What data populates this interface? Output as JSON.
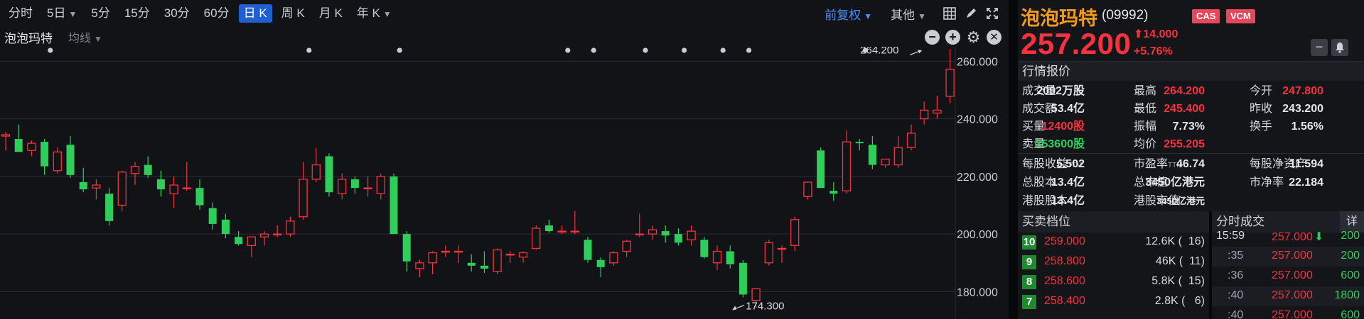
{
  "toolbar": {
    "timeframes": [
      "分时",
      "5日",
      "5分",
      "15分",
      "30分",
      "60分",
      "日 K",
      "周 K",
      "月 K",
      "年 K"
    ],
    "dropdown_flags": [
      false,
      true,
      false,
      false,
      false,
      false,
      false,
      false,
      false,
      true
    ],
    "active_index": 6,
    "adjust": "前复权",
    "other": "其他"
  },
  "chart_header": {
    "stock": "泡泡玛特",
    "indicator": "均线"
  },
  "chart_data": {
    "type": "candlestick",
    "y_ticks": [
      "260.000",
      "240.000",
      "220.000",
      "200.000",
      "180.000"
    ],
    "ylim": [
      170.5,
      265
    ],
    "up_color": "#f4333e",
    "down_color": "#2fce5a",
    "annotations": [
      {
        "text": "264.200",
        "value": 264.2,
        "index": 71
      },
      {
        "text": "174.300",
        "value": 174.3,
        "index": 56
      }
    ],
    "event_marker_indices": [
      4,
      24,
      31,
      44,
      46,
      50,
      53,
      56,
      58,
      67
    ],
    "candles": [
      {
        "o": 234,
        "h": 235.5,
        "l": 229,
        "c": 234.5
      },
      {
        "o": 233,
        "h": 238,
        "l": 228.5,
        "c": 228.5
      },
      {
        "o": 229,
        "h": 232.5,
        "l": 227,
        "c": 231.5
      },
      {
        "o": 232,
        "h": 233,
        "l": 220.5,
        "c": 223.5
      },
      {
        "o": 222,
        "h": 230,
        "l": 221,
        "c": 228.5
      },
      {
        "o": 231,
        "h": 234,
        "l": 219.5,
        "c": 220.5
      },
      {
        "o": 218,
        "h": 223,
        "l": 214.5,
        "c": 215.5
      },
      {
        "o": 216,
        "h": 219,
        "l": 212,
        "c": 217
      },
      {
        "o": 214,
        "h": 216,
        "l": 203,
        "c": 204.5
      },
      {
        "o": 210,
        "h": 222,
        "l": 208,
        "c": 221.5
      },
      {
        "o": 221,
        "h": 225,
        "l": 217,
        "c": 223.5
      },
      {
        "o": 224,
        "h": 227,
        "l": 219.5,
        "c": 220.5
      },
      {
        "o": 219,
        "h": 222,
        "l": 213,
        "c": 215.5
      },
      {
        "o": 214,
        "h": 220,
        "l": 209,
        "c": 217
      },
      {
        "o": 216,
        "h": 225,
        "l": 215,
        "c": 216
      },
      {
        "o": 216,
        "h": 219,
        "l": 208.5,
        "c": 210
      },
      {
        "o": 209,
        "h": 211,
        "l": 201.5,
        "c": 203.5
      },
      {
        "o": 205,
        "h": 207,
        "l": 198.5,
        "c": 200
      },
      {
        "o": 199,
        "h": 201,
        "l": 196,
        "c": 196.5
      },
      {
        "o": 196,
        "h": 198,
        "l": 192,
        "c": 199
      },
      {
        "o": 199,
        "h": 201,
        "l": 196,
        "c": 200
      },
      {
        "o": 200,
        "h": 203,
        "l": 199,
        "c": 200
      },
      {
        "o": 200,
        "h": 206,
        "l": 199,
        "c": 204.5
      },
      {
        "o": 206,
        "h": 225,
        "l": 205,
        "c": 219
      },
      {
        "o": 219,
        "h": 230,
        "l": 218,
        "c": 224
      },
      {
        "o": 227,
        "h": 228,
        "l": 213,
        "c": 214.5
      },
      {
        "o": 214,
        "h": 221,
        "l": 212,
        "c": 219
      },
      {
        "o": 219,
        "h": 220,
        "l": 214,
        "c": 216
      },
      {
        "o": 216,
        "h": 220,
        "l": 213,
        "c": 216
      },
      {
        "o": 214,
        "h": 221,
        "l": 212,
        "c": 220
      },
      {
        "o": 220,
        "h": 221,
        "l": 200,
        "c": 200
      },
      {
        "o": 200,
        "h": 201,
        "l": 187,
        "c": 190.5
      },
      {
        "o": 188,
        "h": 191,
        "l": 185,
        "c": 190
      },
      {
        "o": 190,
        "h": 194,
        "l": 186,
        "c": 193.5
      },
      {
        "o": 194,
        "h": 196,
        "l": 192,
        "c": 194
      },
      {
        "o": 194,
        "h": 196,
        "l": 190,
        "c": 194
      },
      {
        "o": 190,
        "h": 193,
        "l": 187,
        "c": 189
      },
      {
        "o": 189,
        "h": 194,
        "l": 186.5,
        "c": 188
      },
      {
        "o": 187,
        "h": 195,
        "l": 186,
        "c": 194.5
      },
      {
        "o": 193,
        "h": 194,
        "l": 190,
        "c": 193
      },
      {
        "o": 192,
        "h": 194,
        "l": 190,
        "c": 193.5
      },
      {
        "o": 195,
        "h": 203,
        "l": 194.5,
        "c": 202
      },
      {
        "o": 203,
        "h": 205,
        "l": 200.5,
        "c": 201
      },
      {
        "o": 201,
        "h": 203,
        "l": 200,
        "c": 201
      },
      {
        "o": 201,
        "h": 208,
        "l": 200,
        "c": 201
      },
      {
        "o": 198,
        "h": 199,
        "l": 190,
        "c": 191
      },
      {
        "o": 191,
        "h": 192,
        "l": 185,
        "c": 188.5
      },
      {
        "o": 190,
        "h": 194,
        "l": 189,
        "c": 193.5
      },
      {
        "o": 194,
        "h": 198,
        "l": 192,
        "c": 197.5
      },
      {
        "o": 200,
        "h": 207,
        "l": 199,
        "c": 200
      },
      {
        "o": 200,
        "h": 203,
        "l": 198,
        "c": 201.5
      },
      {
        "o": 201,
        "h": 203,
        "l": 197,
        "c": 199.5
      },
      {
        "o": 200,
        "h": 202,
        "l": 196,
        "c": 197
      },
      {
        "o": 198,
        "h": 203,
        "l": 196,
        "c": 201
      },
      {
        "o": 198,
        "h": 199,
        "l": 191.5,
        "c": 192
      },
      {
        "o": 190,
        "h": 196,
        "l": 187.5,
        "c": 194
      },
      {
        "o": 194,
        "h": 196,
        "l": 188,
        "c": 189.5
      },
      {
        "o": 190,
        "h": 191,
        "l": 178,
        "c": 179
      },
      {
        "o": 177,
        "h": 181,
        "l": 174.3,
        "c": 181
      },
      {
        "o": 190,
        "h": 198,
        "l": 189,
        "c": 197
      },
      {
        "o": 195,
        "h": 196,
        "l": 190,
        "c": 195
      },
      {
        "o": 196,
        "h": 206,
        "l": 194,
        "c": 205
      },
      {
        "o": 213,
        "h": 218,
        "l": 212,
        "c": 218
      },
      {
        "o": 229,
        "h": 230,
        "l": 216,
        "c": 216
      },
      {
        "o": 215,
        "h": 218,
        "l": 211.5,
        "c": 214
      },
      {
        "o": 215,
        "h": 236,
        "l": 214,
        "c": 232
      },
      {
        "o": 232,
        "h": 233,
        "l": 229,
        "c": 231.5
      },
      {
        "o": 231,
        "h": 234,
        "l": 222.5,
        "c": 224
      },
      {
        "o": 224,
        "h": 226,
        "l": 223,
        "c": 226
      },
      {
        "o": 224,
        "h": 234,
        "l": 223,
        "c": 230
      },
      {
        "o": 230,
        "h": 238,
        "l": 229,
        "c": 235
      },
      {
        "o": 240,
        "h": 246,
        "l": 238,
        "c": 243
      },
      {
        "o": 242,
        "h": 248,
        "l": 240,
        "c": 243
      },
      {
        "o": 247.8,
        "h": 264.2,
        "l": 245.4,
        "c": 257.2
      }
    ]
  },
  "quote": {
    "name": "泡泡玛特",
    "code": "(09992)",
    "tags": [
      "CAS",
      "VCM"
    ],
    "price": "257.200",
    "change": "14.000",
    "change_pct": "+5.76%",
    "btn_minus": "−",
    "section_title": "行情报价",
    "rows": [
      [
        {
          "label": "成交量",
          "value": "2092万股",
          "color": "neutral"
        },
        {
          "label": "最高",
          "value": "264.200",
          "color": "red"
        },
        {
          "label": "今开",
          "value": "247.800",
          "color": "red"
        }
      ],
      [
        {
          "label": "成交额",
          "value": "53.4亿",
          "color": "neutral"
        },
        {
          "label": "最低",
          "value": "245.400",
          "color": "red"
        },
        {
          "label": "昨收",
          "value": "243.200",
          "color": "neutral"
        }
      ],
      [
        {
          "label": "买量",
          "value": "12400股",
          "color": "red"
        },
        {
          "label": "振幅",
          "value": "7.73%",
          "color": "neutral"
        },
        {
          "label": "换手",
          "value": "1.56%",
          "color": "neutral"
        }
      ],
      [
        {
          "label": "卖量",
          "value": "353600股",
          "color": "green"
        },
        {
          "label": "均价",
          "value": "255.205",
          "color": "red"
        }
      ]
    ],
    "fundamentals": [
      [
        {
          "label": "每股收益",
          "sup": "TTM",
          "value": "5.502"
        },
        {
          "label": "市盈率",
          "sup": "TTM",
          "value": "46.74"
        },
        {
          "label": "每股净资产",
          "sup": "",
          "value": "11.594"
        }
      ],
      [
        {
          "label": "总股本",
          "sup": "",
          "value": "13.4亿"
        },
        {
          "label": "总市值",
          "sup": "",
          "value": "3450亿港元"
        },
        {
          "label": "市净率",
          "sup": "",
          "value": "22.184"
        }
      ],
      [
        {
          "label": "港股股本",
          "sup": "",
          "value": "13.4亿"
        },
        {
          "label": "港股市值",
          "sup": "",
          "value": "3450亿港元"
        }
      ]
    ]
  },
  "order_book": {
    "title": "买卖档位",
    "levels": [
      {
        "level": "10",
        "price": "259.000",
        "volume": "12.6K (  16)"
      },
      {
        "level": "9",
        "price": "258.800",
        "volume": "46K (  11)"
      },
      {
        "level": "8",
        "price": "258.600",
        "volume": "5.8K (  15)"
      },
      {
        "level": "7",
        "price": "258.400",
        "volume": "2.8K (   6)"
      }
    ]
  },
  "ticks": {
    "title": "分时成交",
    "detail": "详",
    "rows": [
      {
        "time": "15:59",
        "price": "257.000",
        "arrow": "down",
        "volume": "200"
      },
      {
        "time": ":35",
        "price": "257.000",
        "arrow": "",
        "volume": "200"
      },
      {
        "time": ":36",
        "price": "257.000",
        "arrow": "",
        "volume": "600"
      },
      {
        "time": ":40",
        "price": "257.000",
        "arrow": "",
        "volume": "1800"
      },
      {
        "time": ":40",
        "price": "257.000",
        "arrow": "",
        "volume": "600"
      }
    ]
  }
}
